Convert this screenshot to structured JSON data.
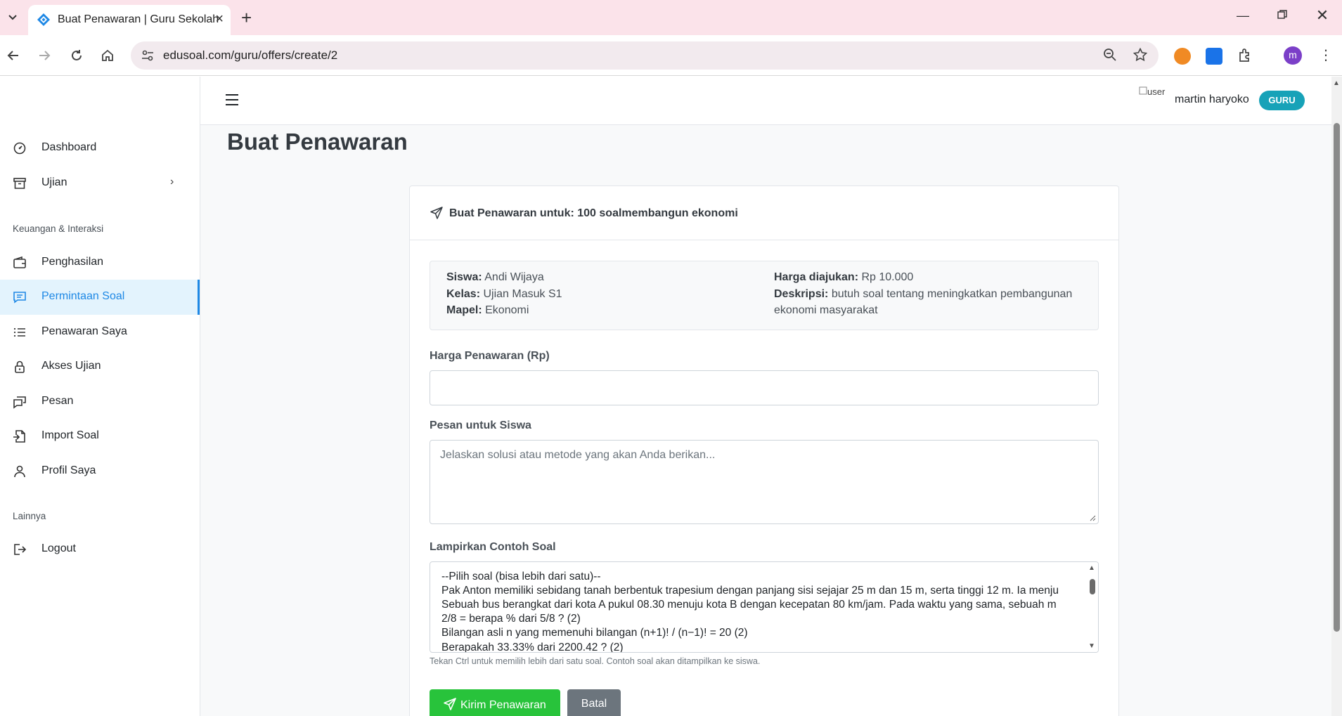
{
  "browser": {
    "tab_title": "Buat Penawaran | Guru Sekolah",
    "url": "edusoal.com/guru/offers/create/2",
    "profile_initial": "m"
  },
  "sidebar": {
    "items_top": [
      {
        "label": "Dashboard",
        "icon": "gauge-icon"
      },
      {
        "label": "Ujian",
        "icon": "archive-icon"
      }
    ],
    "section_finance": "Keuangan & Interaksi",
    "items_finance": [
      {
        "label": "Penghasilan",
        "icon": "wallet-icon"
      },
      {
        "label": "Permintaan Soal",
        "icon": "chat-icon"
      },
      {
        "label": "Penawaran Saya",
        "icon": "list-icon"
      },
      {
        "label": "Akses Ujian",
        "icon": "lock-icon"
      },
      {
        "label": "Pesan",
        "icon": "message-icon"
      },
      {
        "label": "Import Soal",
        "icon": "file-import-icon"
      },
      {
        "label": "Profil Saya",
        "icon": "user-icon"
      }
    ],
    "section_other": "Lainnya",
    "logout_label": "Logout"
  },
  "header": {
    "user_img_alt": "user",
    "user_name": "martin haryoko",
    "role_badge": "GURU"
  },
  "page": {
    "title": "Buat Penawaran",
    "card_title": "Buat Penawaran untuk: 100 soalmembangun ekonomi",
    "info": {
      "siswa_label": "Siswa:",
      "siswa": "Andi Wijaya",
      "kelas_label": "Kelas:",
      "kelas": "Ujian Masuk S1",
      "mapel_label": "Mapel:",
      "mapel": "Ekonomi",
      "harga_label": "Harga diajukan:",
      "harga": "Rp 10.000",
      "deskripsi_label": "Deskripsi:",
      "deskripsi_1": "butuh soal tentang meningkatkan pembangunan",
      "deskripsi_2": "ekonomi masyarakat"
    },
    "price_label": "Harga Penawaran (Rp)",
    "price_value": "",
    "message_label": "Pesan untuk Siswa",
    "message_placeholder": "Jelaskan solusi atau metode yang akan Anda berikan...",
    "attach_label": "Lampirkan Contoh Soal",
    "attach_options": [
      "--Pilih soal (bisa lebih dari satu)--",
      "Pak Anton memiliki sebidang tanah berbentuk trapesium dengan panjang sisi sejajar 25 m dan 15 m, serta tinggi 12 m. Ia menju",
      "Sebuah bus berangkat dari kota A pukul 08.30 menuju kota B dengan kecepatan 80 km/jam. Pada waktu yang sama, sebuah m",
      "2/8 = berapa % dari 5/8 ? (2)",
      "Bilangan asli n yang memenuhi bilangan (n+1)! / (n−1)! = 20 (2)",
      "Berapakah 33.33% dari 2200.42 ? (2)"
    ],
    "attach_help": "Tekan Ctrl untuk memilih lebih dari satu soal. Contoh soal akan ditampilkan ke siswa.",
    "submit_label": "Kirim Penawaran",
    "cancel_label": "Batal"
  },
  "colors": {
    "accent": "#1e88e5",
    "success": "#28c33b",
    "secondary": "#6c757d",
    "badge": "#17a2b8",
    "tabbar": "#fbe3ea"
  }
}
